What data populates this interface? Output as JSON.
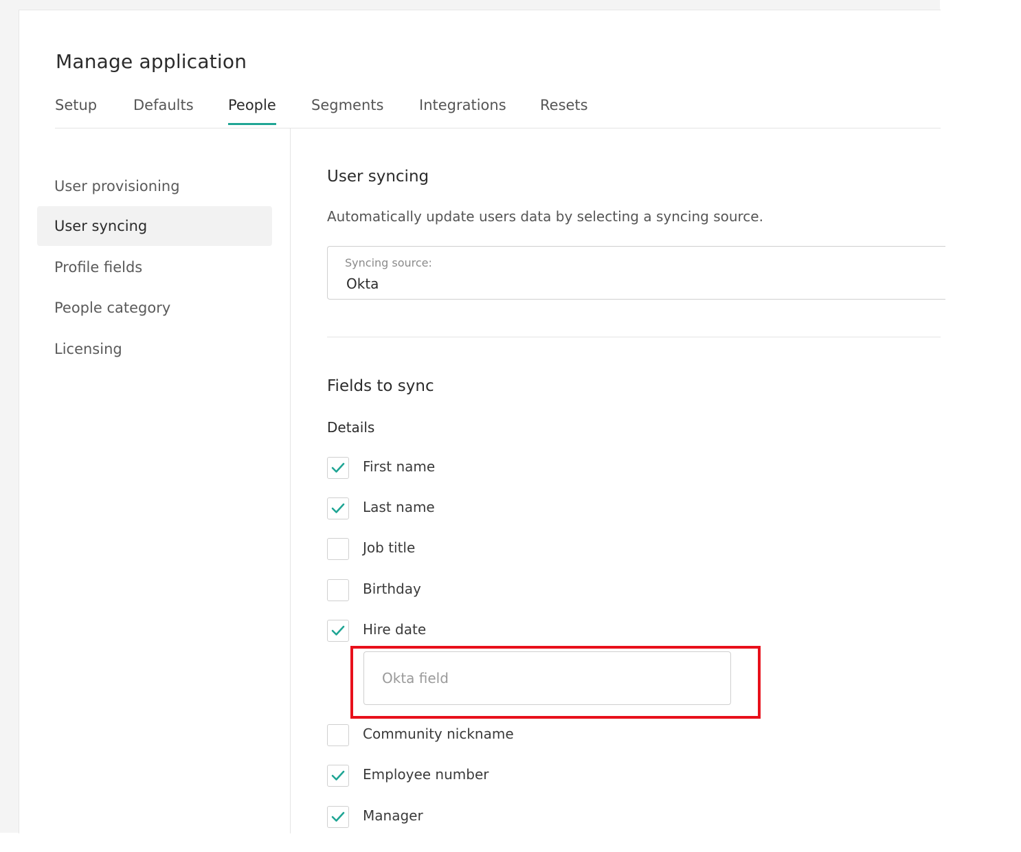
{
  "header": {
    "title": "Manage application"
  },
  "tabs": [
    {
      "label": "Setup"
    },
    {
      "label": "Defaults"
    },
    {
      "label": "People"
    },
    {
      "label": "Segments"
    },
    {
      "label": "Integrations"
    },
    {
      "label": "Resets"
    }
  ],
  "active_tab": "People",
  "sidebar": {
    "items": [
      {
        "label": "User provisioning"
      },
      {
        "label": "User syncing"
      },
      {
        "label": "Profile fields"
      },
      {
        "label": "People category"
      },
      {
        "label": "Licensing"
      }
    ],
    "active": "User syncing"
  },
  "main": {
    "title": "User syncing",
    "description": "Automatically update users data by selecting a syncing source.",
    "syncing_source": {
      "label": "Syncing source:",
      "value": "Okta"
    },
    "fields_title": "Fields to sync",
    "details_label": "Details",
    "fields": [
      {
        "label": "First name",
        "checked": true
      },
      {
        "label": "Last name",
        "checked": true
      },
      {
        "label": "Job title",
        "checked": false
      },
      {
        "label": "Birthday",
        "checked": false
      },
      {
        "label": "Hire date",
        "checked": true
      },
      {
        "label": "Community nickname",
        "checked": false
      },
      {
        "label": "Employee number",
        "checked": true
      },
      {
        "label": "Manager",
        "checked": true
      }
    ],
    "okta_field": {
      "placeholder": "Okta field",
      "value": ""
    }
  },
  "colors": {
    "accent": "#1fa594",
    "highlight": "#e8101b",
    "active_bg": "#f2f2f2",
    "border": "#cfcfcf"
  }
}
